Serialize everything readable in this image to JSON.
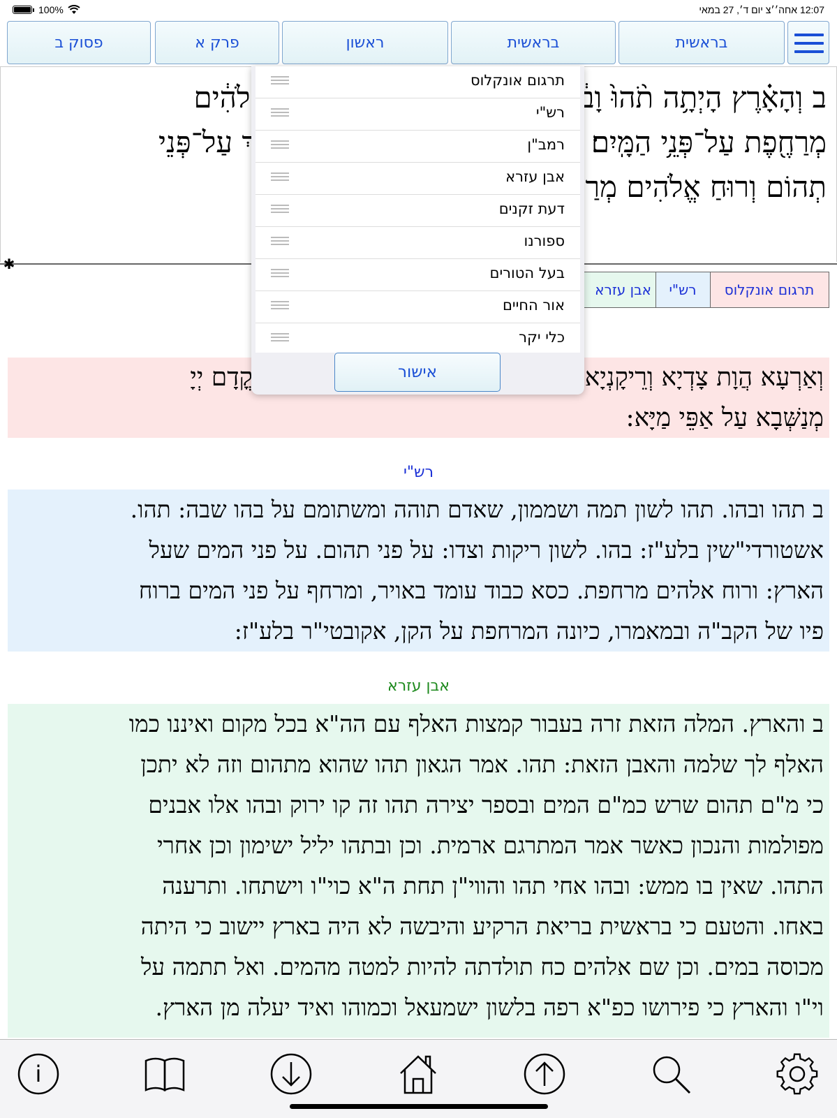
{
  "status": {
    "battery": "100%",
    "time_date": "12:07 אחה׳׳צ  יום ד׳, 27 במאי"
  },
  "nav": {
    "verse": "פסוק ב",
    "chapter": "פרק א",
    "aliyah": "ראשון",
    "parsha": "בראשית",
    "book": "בראשית"
  },
  "verse_lines": [
    "ב וְהָאָ֗רֶץ הָיְתָ֥ה תֹ֨הוּ֙ וָבֹ֔הוּ וְחֹ֖שֶׁךְ עַל־פְּנֵ֣י תְה֑וֹם וְר֣וּחַ אֱלֹהִ֔ים",
    "מְרַחֶ֖פֶת עַל־פְּנֵ֥י הַמָּֽיִם׃ ב וְהָאָרֶץ הָיְתָה תֹהוּ וָבֹהוּ וְחֹשֶׁךְ עַל־פְּנֵי",
    "תְהוֹם וְרוּחַ אֱלֹהִים מְרַחֶפֶת עַל־פְּנֵי הַמָּיִם׃"
  ],
  "verse_number": "ב",
  "splitter_glyph": "✱",
  "commentary_tabs": [
    "תרגום אונקלוס",
    "רש\"י",
    "אבן עזרא"
  ],
  "onkelos": {
    "lines": [
      "וְאַרְעָא הֲוָת צָדְיָא וְרֵיקָנְיָא וַחֲשׁוֹכָא עַל אַפֵּי תְהוֹמָא וְרוּחָא מִן קֳדָם יְיָ",
      "מְנַשְּׁבָא עַל אַפֵּי מַיָּא:"
    ]
  },
  "rashi": {
    "title": "רש\"י",
    "lines": [
      "ב תהו ובהו. תהו לשון תמה ושממון, שאדם תוהה ומשתומם על בהו שבה: תהו.",
      "אשטורדי\"שין בלע\"ז: בהו. לשון ריקות וצדו: על פני תהום. על פני המים שעל",
      "הארץ: ורוח אלהים מרחפת. כסא כבוד עומד באויר, ומרחף על פני המים ברוח",
      "פיו של הקב\"ה ובמאמרו, כיונה המרחפת על הקן, אקובטי\"ר בלע\"ז:"
    ]
  },
  "ibn_ezra": {
    "title": "אבן עזרא",
    "lines": [
      "ב והארץ. המלה הזאת זרה בעבור קמצות האלף עם הה\"א בכל מקום ואיננו כמו",
      "האלף לך שלמה והאבן הזאת: תהו. אמר הגאון תהו שהוא מתהום וזה לא יתכן",
      "כי מ\"ם תהום שרש כמ\"ם המים ובספר יצירה תהו זה קו ירוק ובהו אלו אבנים",
      "מפולמות והנכון כאשר אמר המתרגם ארמית. וכן ובתהו יליל ישימון וכן אחרי",
      "התהו. שאין בו ממש: ובהו אחי תהו והווי\"ן תחת ה\"א כוי\"ו וישתחו. ותרענה",
      "באחו. והטעם כי בראשית בריאת הרקיע והיבשה לא היה בארץ יישוב כי היתה",
      "מכוסה במים. וכן שם אלהים כח תולדתה להיות למטה מהמים. ואל תתמה על",
      "וי\"ו והארץ כי פירושו כפ\"א רפה בלשון ישמעאל וכמוהו ואיד יעלה מן הארץ."
    ]
  },
  "popup": {
    "items": [
      "תרגום אונקלוס",
      "רש\"י",
      "רמב\"ן",
      "אבן עזרא",
      "דעת זקנים",
      "ספורנו",
      "בעל הטורים",
      "אור החיים",
      "כלי יקר"
    ],
    "confirm": "אישור"
  },
  "toolbar": {
    "info": "i"
  },
  "colors": {
    "accent": "#1a4fd6",
    "onkelos_bg": "#fde5e5",
    "rashi_bg": "#e4f1fc",
    "ibn_ezra_bg": "#e6f8ee",
    "rashi_title": "#1a2fd6",
    "ibn_ezra_title": "#1e8a1e"
  }
}
